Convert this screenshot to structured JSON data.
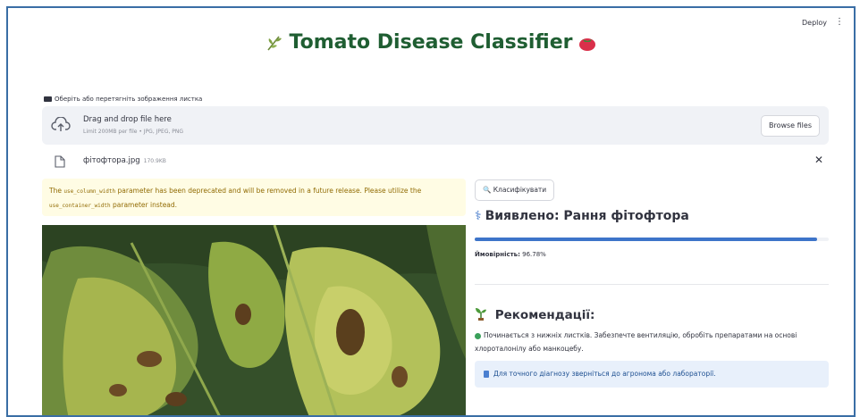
{
  "header": {
    "deploy_label": "Deploy",
    "menu_icon": "more-vertical-icon"
  },
  "title": {
    "text": "Tomato Disease Classifier",
    "left_icon": "herb-icon",
    "right_icon": "tomato-icon"
  },
  "uploader": {
    "label": "Оберіть або перетягніть зображення листка",
    "drop_title": "Drag and drop file here",
    "limit": "Limit 200MB per file • JPG, JPEG, PNG",
    "browse_label": "Browse files"
  },
  "file": {
    "name": "фітофтора.jpg",
    "size": "170.9KB"
  },
  "warning": {
    "text_1": "The ",
    "code_1": "use_column_width",
    "text_2": " parameter has been deprecated and will be removed in a future release. Please utilize the",
    "code_2": "use_container_width",
    "text_3": " parameter instead."
  },
  "results": {
    "classify_label": "🔍 Класифікувати",
    "detected": "Виявлено: Рання фітофтора",
    "confidence": 0.9678,
    "prob_label": "Ймовірність:",
    "prob_value": "96.78%",
    "rec_title": "Рекомендації:",
    "rec_text": "Починається з нижніх листків. Забезпечте вентиляцію, обробіть препаратами на основі хлороталонілу або манкоцебу.",
    "info_text": "Для точного діагнозу зверніться до агронома або лабораторії."
  },
  "colors": {
    "title": "#1f5e32",
    "progress": "#3d74c9",
    "warning_bg": "#fffce4",
    "info_bg": "#e8f0fb"
  }
}
